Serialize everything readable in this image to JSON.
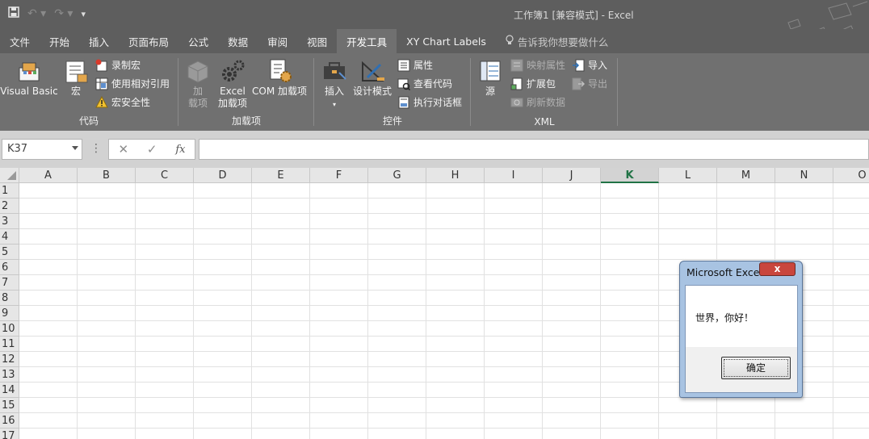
{
  "window": {
    "title": "工作簿1  [兼容模式]  -  Excel"
  },
  "qat": {
    "save_icon": "save-icon",
    "undo_icon": "undo-icon",
    "redo_icon": "redo-icon",
    "customize_icon": "customize-qat-icon"
  },
  "tabs": [
    {
      "label": "文件"
    },
    {
      "label": "开始"
    },
    {
      "label": "插入"
    },
    {
      "label": "页面布局"
    },
    {
      "label": "公式"
    },
    {
      "label": "数据"
    },
    {
      "label": "审阅"
    },
    {
      "label": "视图"
    },
    {
      "label": "开发工具"
    },
    {
      "label": "XY Chart Labels"
    }
  ],
  "tell_me": "告诉我你想要做什么",
  "ribbon": {
    "code": {
      "label": "代码",
      "visual_basic": "Visual Basic",
      "macro": "宏",
      "record_macro": "录制宏",
      "relative_ref": "使用相对引用",
      "macro_security": "宏安全性"
    },
    "addins": {
      "label": "加载项",
      "addins_l1": "加",
      "addins_l2": "载项",
      "excel_addins_l1": "Excel",
      "excel_addins_l2": "加载项",
      "com_addins": "COM 加载项"
    },
    "controls": {
      "label": "控件",
      "insert": "插入",
      "design_mode": "设计模式",
      "properties": "属性",
      "view_code": "查看代码",
      "run_dialog": "执行对话框"
    },
    "xml": {
      "label": "XML",
      "source": "源",
      "map_properties": "映射属性",
      "expansion_packs": "扩展包",
      "refresh_data": "刷新数据",
      "import": "导入",
      "export": "导出"
    }
  },
  "formula_bar": {
    "name_box": "K37",
    "fx": "fx",
    "cancel": "✕",
    "enter": "✓",
    "value": ""
  },
  "sheet": {
    "columns": [
      "A",
      "B",
      "C",
      "D",
      "E",
      "F",
      "G",
      "H",
      "I",
      "J",
      "K",
      "L",
      "M",
      "N",
      "O"
    ],
    "selected_column": "K",
    "rows": [
      "1",
      "2",
      "3",
      "4",
      "5",
      "6",
      "7",
      "8",
      "9",
      "10",
      "11",
      "12",
      "13",
      "14",
      "15",
      "16",
      "17"
    ]
  },
  "dialog": {
    "title": "Microsoft Excel",
    "close_label": "x",
    "message": "世界，你好！",
    "ok_label": "确定"
  }
}
